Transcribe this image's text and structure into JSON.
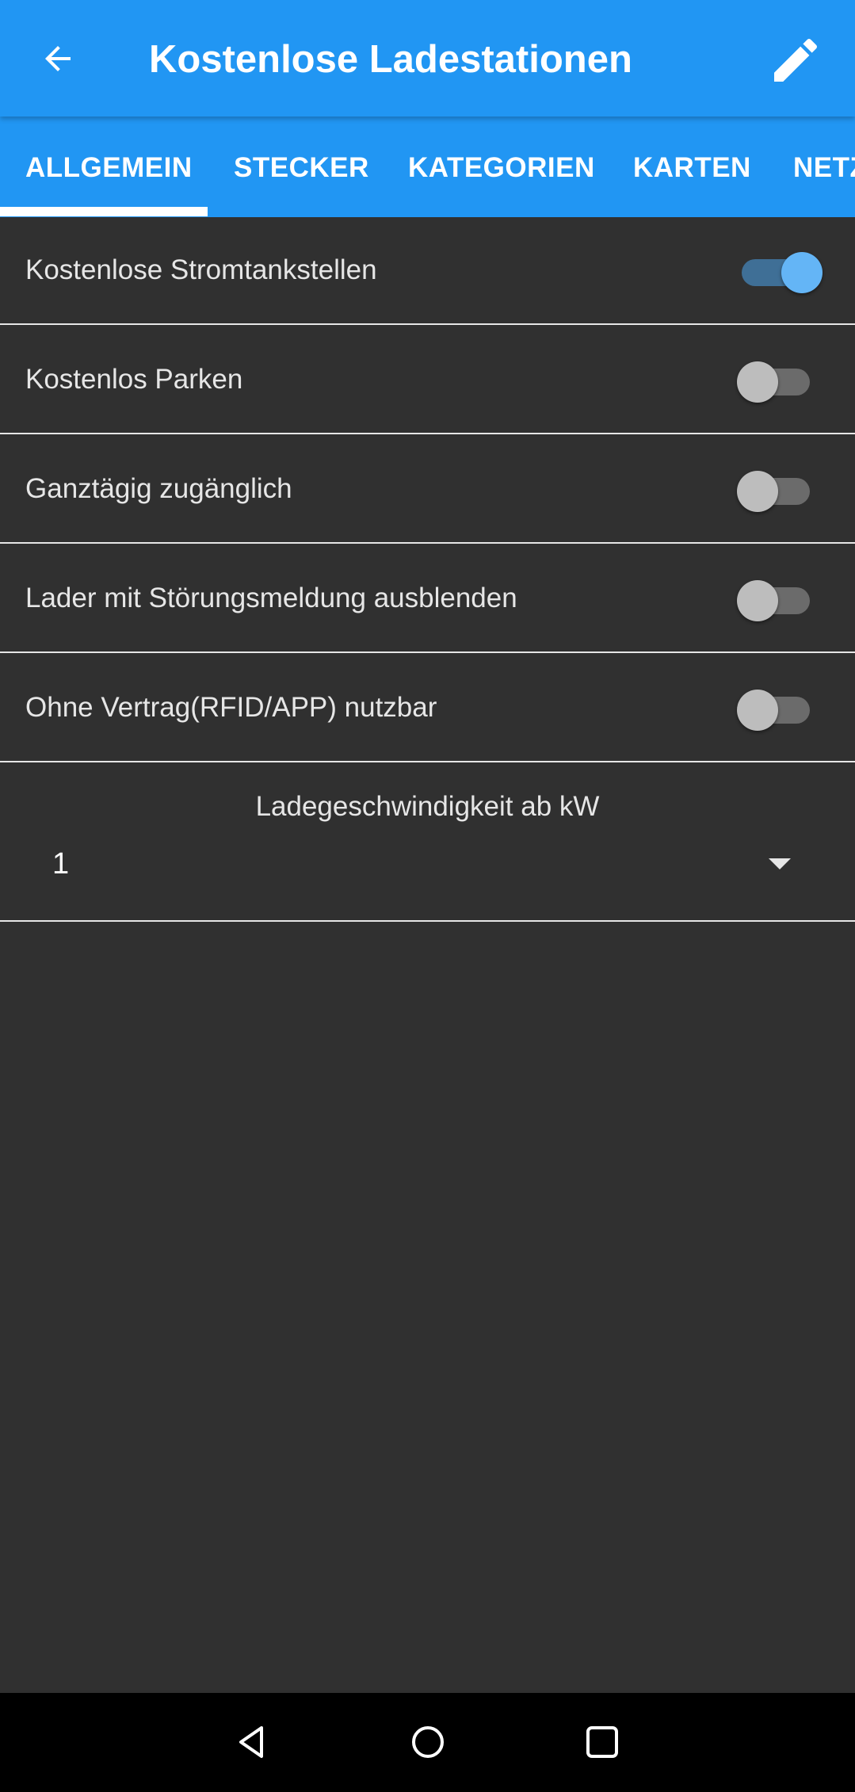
{
  "header": {
    "title": "Kostenlose Ladestationen",
    "back_icon": "arrow-left-icon",
    "edit_icon": "pencil-icon"
  },
  "tabs": [
    {
      "label": "ALLGEMEIN",
      "selected": true
    },
    {
      "label": "STECKER",
      "selected": false
    },
    {
      "label": "KATEGORIEN",
      "selected": false
    },
    {
      "label": "KARTEN",
      "selected": false
    },
    {
      "label": "NETZ",
      "selected": false
    }
  ],
  "settings": [
    {
      "label": "Kostenlose Stromtankstellen",
      "enabled": true
    },
    {
      "label": "Kostenlos Parken",
      "enabled": false
    },
    {
      "label": "Ganztägig zugänglich",
      "enabled": false
    },
    {
      "label": "Lader mit Störungsmeldung ausblenden",
      "enabled": false
    },
    {
      "label": "Ohne Vertrag(RFID/APP) nutzbar",
      "enabled": false
    }
  ],
  "speed": {
    "label": "Ladegeschwindigkeit ab kW",
    "value": "1"
  },
  "colors": {
    "primary": "#2196f3",
    "background": "#303030",
    "switch_on": "#64b5f6"
  },
  "navbar": {
    "icons": [
      "back-triangle-icon",
      "home-circle-icon",
      "recents-square-icon"
    ]
  }
}
